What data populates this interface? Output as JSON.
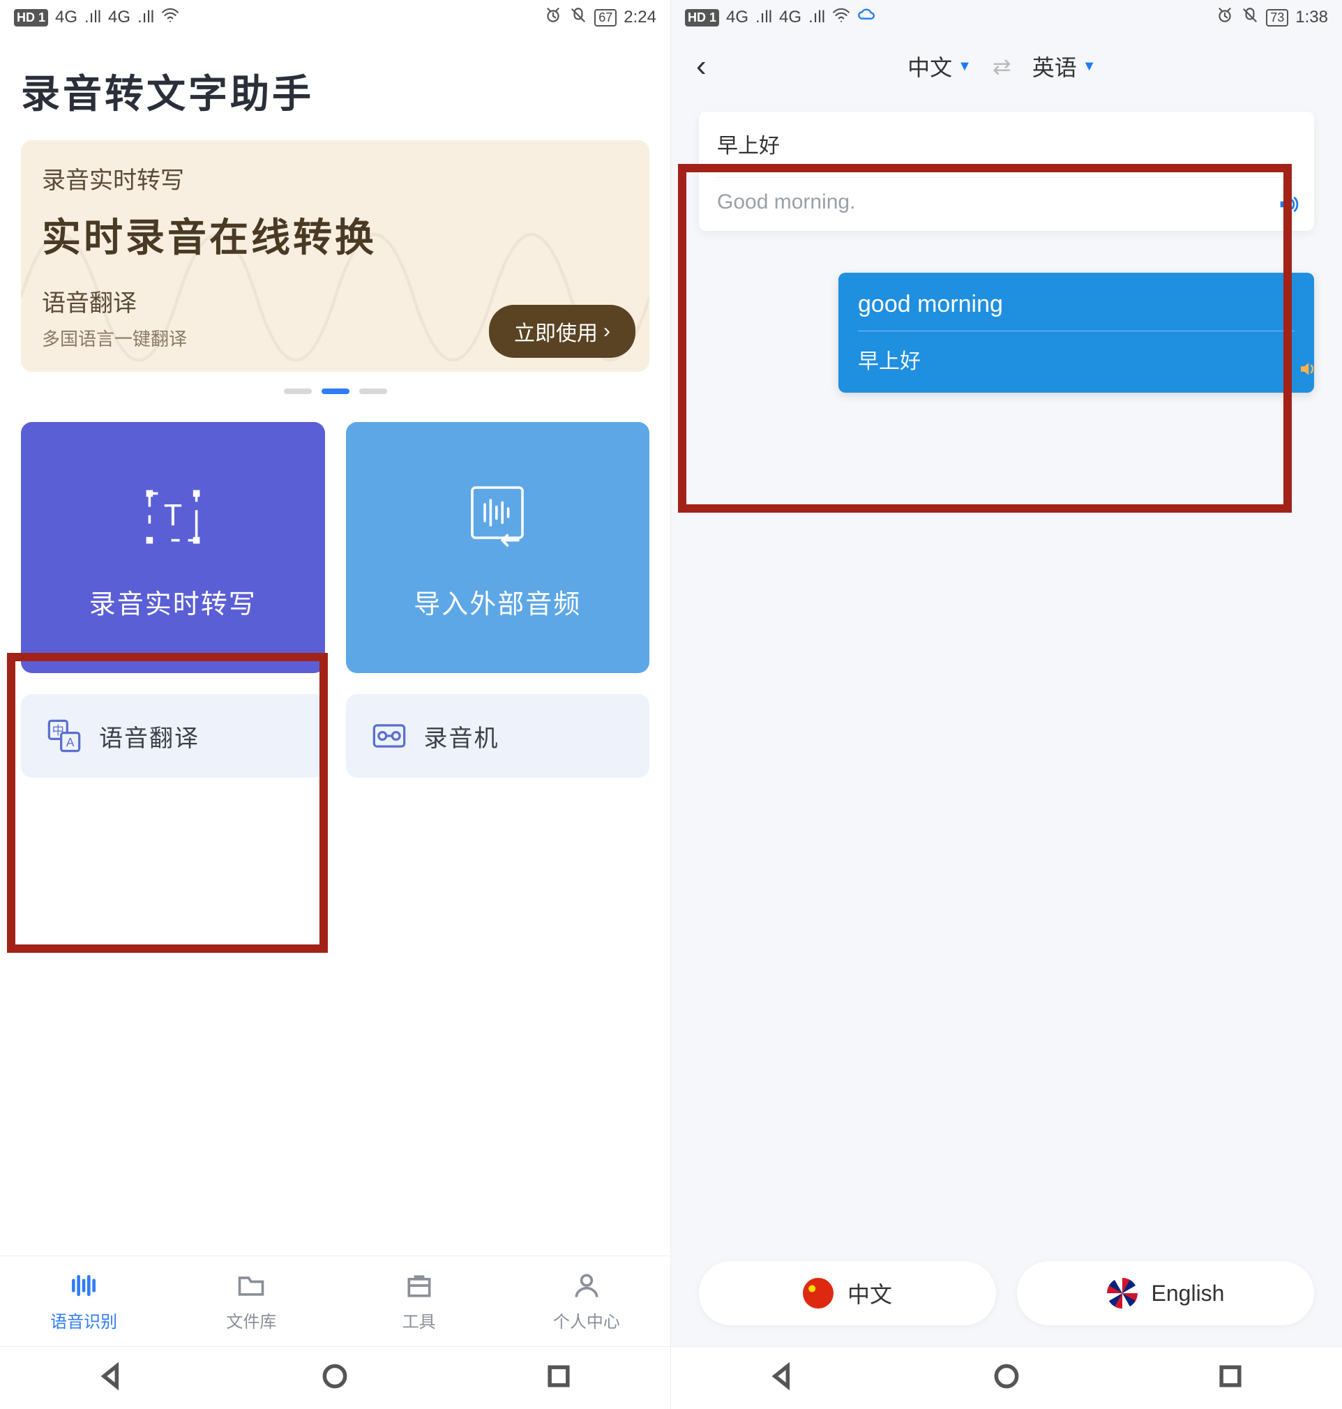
{
  "left": {
    "statusbar": {
      "hd": "HD 1",
      "net1": "4G",
      "net2": "4G",
      "battery": "67",
      "time": "2:24"
    },
    "appTitle": "录音转文字助手",
    "hero": {
      "line1": "录音实时转写",
      "line2": "实时录音在线转换",
      "line3": "语音翻译",
      "line4": "多国语言一键翻译",
      "cta": "立即使用"
    },
    "cards": {
      "purple": "录音实时转写",
      "blue": "导入外部音频"
    },
    "secondary": {
      "translate": "语音翻译",
      "recorder": "录音机"
    },
    "tabs": {
      "voice": "语音识别",
      "files": "文件库",
      "tools": "工具",
      "me": "个人中心"
    }
  },
  "right": {
    "statusbar": {
      "hd": "HD 1",
      "net1": "4G",
      "net2": "4G",
      "battery": "73",
      "time": "1:38"
    },
    "langs": {
      "src": "中文",
      "dst": "英语"
    },
    "card": {
      "src": "早上好",
      "dst": "Good morning."
    },
    "bubble": {
      "src": "good morning",
      "dst": "早上好"
    },
    "buttons": {
      "cn": "中文",
      "en": "English"
    }
  }
}
